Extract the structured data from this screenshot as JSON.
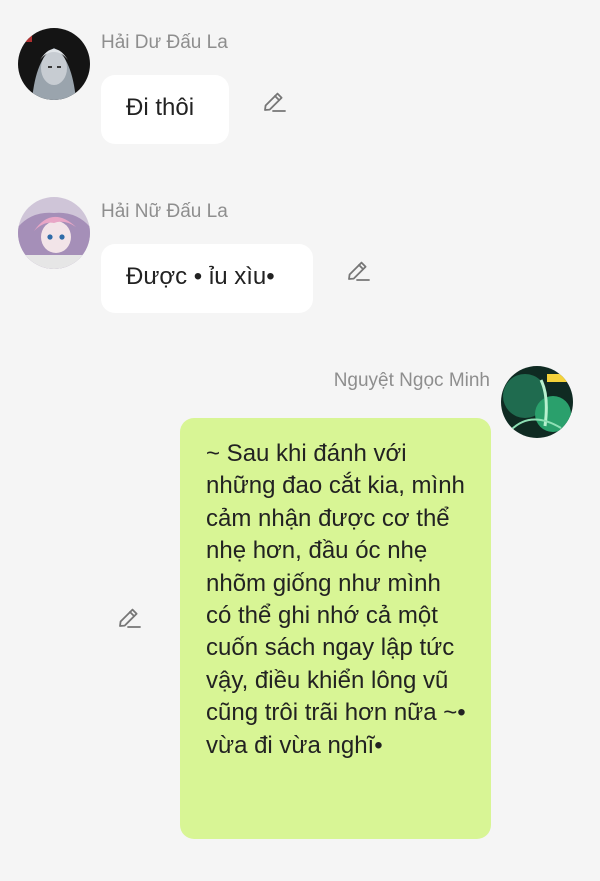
{
  "messages": [
    {
      "sender": "Hải Dư Đấu La",
      "text": "Đi thôi",
      "avatar_icon": "dark-anime-avatar-icon"
    },
    {
      "sender": "Hải Nữ Đấu La",
      "text": "Được • ỉu xìu•",
      "avatar_icon": "pink-anime-avatar-icon"
    },
    {
      "sender": "Nguyệt Ngọc Minh",
      "text": "~ Sau khi đánh với những đao cắt kia, mình cảm nhận được cơ thể nhẹ hơn, đầu óc nhẹ nhõm giống như mình có thể ghi nhớ cả một cuốn sách ngay lập tức vậy, điều khiển lông vũ cũng trôi trãi hơn nữa ~• vừa đi vừa nghĩ•",
      "avatar_icon": "green-anime-avatar-icon"
    }
  ],
  "edit_icon": "pencil-edit-icon",
  "colors": {
    "background": "#f5f5f5",
    "incoming_bubble": "#ffffff",
    "outgoing_bubble": "#d8f595",
    "sender_name": "#8e8e8e",
    "message_text": "#222222"
  }
}
